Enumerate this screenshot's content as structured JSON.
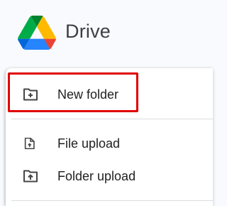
{
  "app": {
    "title": "Drive",
    "logo_icon": "google-drive-logo-icon",
    "brand_colors": {
      "green": "#1ea362",
      "blue": "#4688f4",
      "yellow": "#ffba00",
      "red": "#e94235",
      "dark_green": "#188038",
      "dark_blue": "#1967d2"
    }
  },
  "new_menu": {
    "items": [
      {
        "label": "New folder",
        "icon": "folder-plus-icon"
      },
      {
        "label": "File upload",
        "icon": "file-upload-icon"
      },
      {
        "label": "Folder upload",
        "icon": "folder-upload-icon"
      }
    ],
    "highlight_color": "#e00000"
  }
}
